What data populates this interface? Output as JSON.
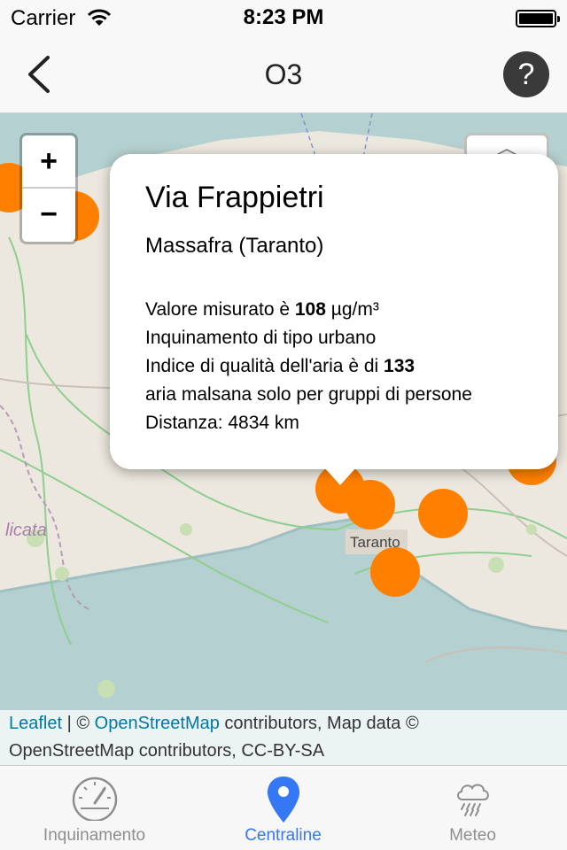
{
  "status_bar": {
    "carrier": "Carrier",
    "time": "8:23 PM",
    "wifi_icon": "wifi-icon",
    "battery_icon": "battery-icon"
  },
  "nav": {
    "title": "O3",
    "back_icon": "chevron-left-icon",
    "help_label": "?"
  },
  "map": {
    "zoom_in_label": "+",
    "zoom_out_label": "−",
    "layers_icon": "layers-icon",
    "place_labels": {
      "taranto": "Taranto",
      "basilicata": "licata"
    },
    "station_color": "#ff8000",
    "popup": {
      "title": "Via Frappietri",
      "subtitle": "Massafra (Taranto)",
      "value_prefix": "Valore misurato è ",
      "value": "108",
      "value_unit": " µg/m³",
      "pollution_type": "Inquinamento di tipo urbano",
      "index_prefix": "Indice di qualità dell'aria è di ",
      "index_value": "133",
      "air_quality": "aria malsana solo per gruppi di persone",
      "distance": "Distanza: 4834 km"
    },
    "attribution": {
      "leaflet": "Leaflet",
      "sep": " | © ",
      "osm_link": "OpenStreetMap",
      "rest1": " contributors, Map data ©",
      "rest2": "OpenStreetMap contributors, CC-BY-SA"
    }
  },
  "tabs": [
    {
      "label": "Inquinamento",
      "icon": "gauge-icon",
      "active": false
    },
    {
      "label": "Centraline",
      "icon": "map-pin-icon",
      "active": true
    },
    {
      "label": "Meteo",
      "icon": "rain-cloud-icon",
      "active": false
    }
  ],
  "colors": {
    "accent": "#3478f6",
    "station": "#ff8000",
    "sea": "#b5d0d0",
    "land": "#ece8df"
  }
}
